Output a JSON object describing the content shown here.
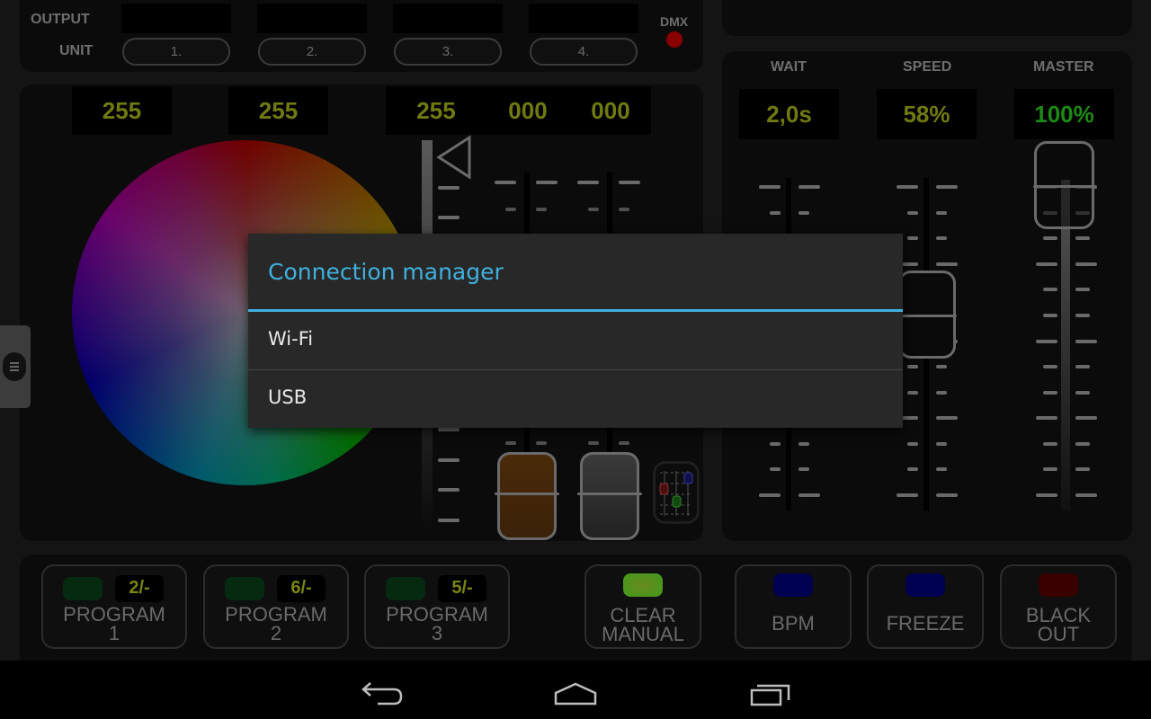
{
  "output_row": {
    "output_label": "OUTPUT",
    "unit_label": "UNIT",
    "units": [
      "1.",
      "2.",
      "3.",
      "4."
    ],
    "dmx_label": "DMX",
    "dmx_status_color": "#8a0000"
  },
  "color_values": [
    "255",
    "255",
    "255",
    "000",
    "000"
  ],
  "right_sliders": {
    "wait": {
      "label": "WAIT",
      "value": "2,0s"
    },
    "speed": {
      "label": "SPEED",
      "value": "58%",
      "level": 0.58
    },
    "master": {
      "label": "MASTER",
      "value": "100%",
      "level": 1.0
    }
  },
  "programs": [
    {
      "label_line1": "PROGRAM",
      "label_line2": "1",
      "badge": "2/-"
    },
    {
      "label_line1": "PROGRAM",
      "label_line2": "2",
      "badge": "6/-"
    },
    {
      "label_line1": "PROGRAM",
      "label_line2": "3",
      "badge": "5/-"
    }
  ],
  "actions": {
    "clear_manual": {
      "line1": "CLEAR",
      "line2": "MANUAL",
      "led_color": "#3f9a1a"
    },
    "bpm": {
      "label": "BPM",
      "led_color": "#000050"
    },
    "freeze": {
      "label": "FREEZE",
      "led_color": "#000050"
    },
    "blackout": {
      "line1": "BLACK",
      "line2": "OUT",
      "led_color": "#3a0000"
    }
  },
  "dialog": {
    "title": "Connection manager",
    "options": [
      "Wi-Fi",
      "USB"
    ],
    "accent_color": "#3fb0dd"
  },
  "navbar": {
    "back": "back-icon",
    "home": "home-icon",
    "recents": "recents-icon"
  }
}
